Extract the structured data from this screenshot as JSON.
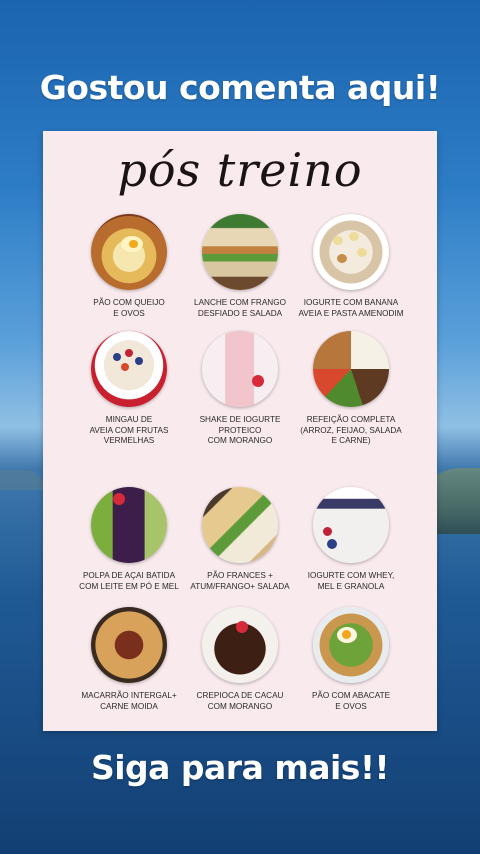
{
  "header": {
    "title": "Gostou comenta aqui!"
  },
  "card": {
    "title": "pós treino",
    "items": [
      {
        "label": "PÃO COM QUEIJO\nE OVOS",
        "icon": "bread-cheese-eggs-photo"
      },
      {
        "label": "LANCHE COM FRANGO\nDESFIADO E SALADA",
        "icon": "chicken-sandwich-photo"
      },
      {
        "label": "IOGURTE COM BANANA\nAVEIA E PASTA AMENODIM",
        "icon": "yogurt-banana-photo"
      },
      {
        "label": "MINGAU DE\nAVEIA COM FRUTAS\nVERMELHAS",
        "icon": "oatmeal-berries-photo"
      },
      {
        "label": "SHAKE DE IOGURTE\nPROTEICO\nCOM MORANGO",
        "icon": "strawberry-shake-photo"
      },
      {
        "label": "REFEIÇÃO COMPLETA\n(ARROZ, FEIJAO, SALADA\nE CARNE)",
        "icon": "full-meal-photo"
      },
      {
        "label": "POLPA DE AÇAI BATIDA\nCOM LEITE EM PÓ E MEL",
        "icon": "acai-smoothie-photo"
      },
      {
        "label": "PÃO FRANCES +\nATUM/FRANGO+ SALADA",
        "icon": "french-bread-sandwich-photo"
      },
      {
        "label": "IOGURTE COM WHEY,\nMEL E GRANOLA",
        "icon": "yogurt-granola-photo"
      },
      {
        "label": "MACARRÃO INTERGAL+\nCARNE MOIDA",
        "icon": "spaghetti-meat-photo"
      },
      {
        "label": "CREPIOCA DE CACAU\nCOM MORANGO",
        "icon": "cocoa-crepe-photo"
      },
      {
        "label": "PÃO COM ABACATE\nE OVOS",
        "icon": "avocado-toast-eggs-photo"
      }
    ]
  },
  "footer": {
    "title": "Siga para mais!!"
  }
}
